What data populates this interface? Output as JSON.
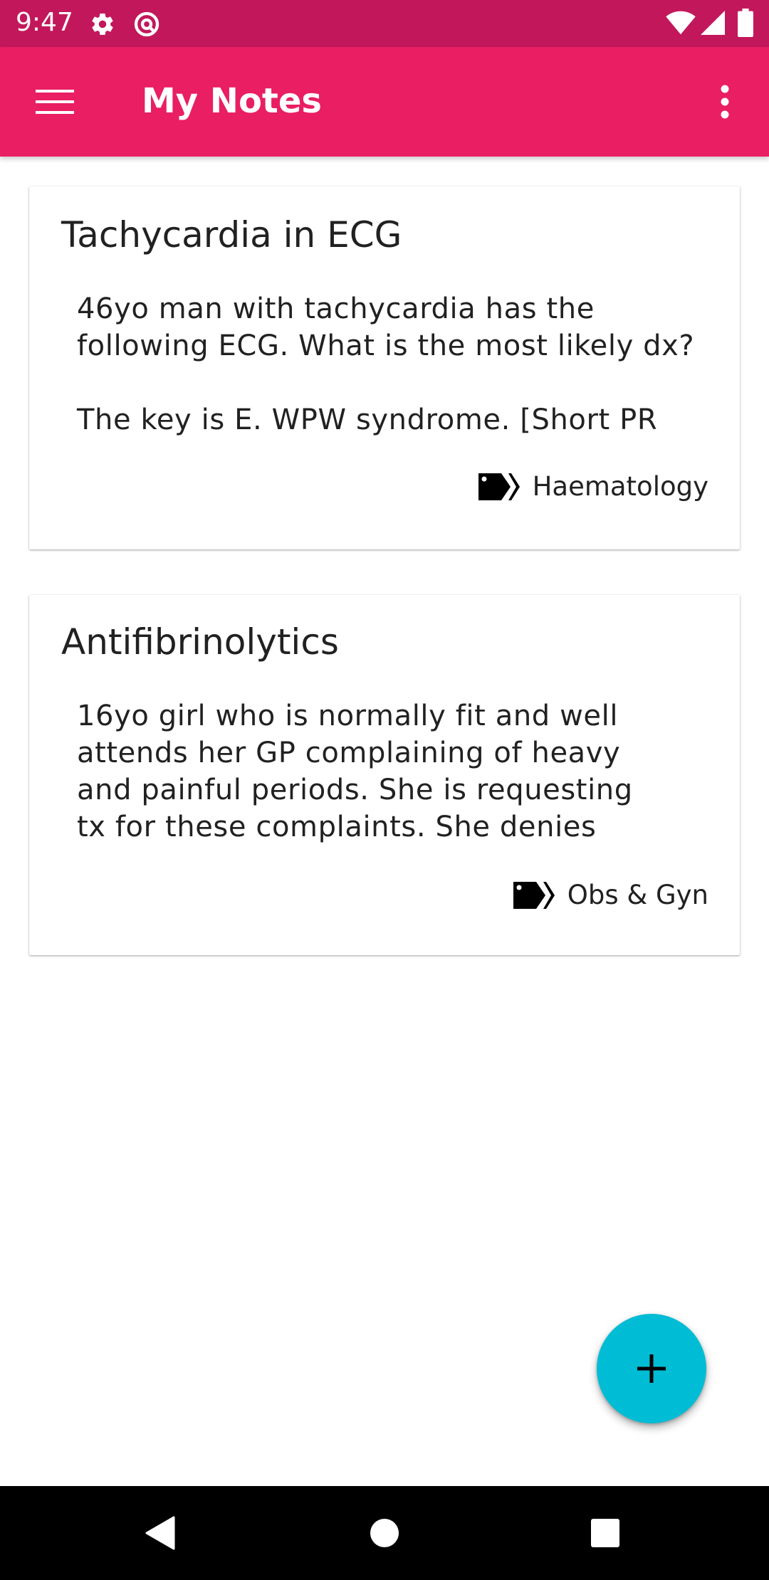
{
  "status_bar": {
    "time": "9:47",
    "icons": [
      "settings-icon",
      "sync-icon",
      "wifi-icon",
      "cellular-signal-icon",
      "battery-icon"
    ]
  },
  "app_bar": {
    "title": "My Notes",
    "menu_icon": "hamburger-menu-icon",
    "overflow_icon": "more-vert-icon",
    "background_color": "#e91e63",
    "status_color": "#c2185b"
  },
  "notes": [
    {
      "title": "Tachycardia in ECG",
      "body": "46yo man with tachycardia has the\nfollowing ECG. What is the most likely dx?\n\nThe key is E. WPW syndrome. [Short PR",
      "tag": "Haematology",
      "tag_icon": "tags-icon"
    },
    {
      "title": "Antifibrinolytics",
      "body": "16yo girl who is normally fit and well\nattends her GP complaining of heavy\nand painful periods. She is requesting\ntx for these complaints. She denies",
      "tag": "Obs & Gyn",
      "tag_icon": "tags-icon"
    }
  ],
  "fab": {
    "icon": "plus-icon",
    "color": "#00bcd4"
  },
  "nav_bar": {
    "icons": [
      "back-icon",
      "home-icon",
      "recents-icon"
    ]
  }
}
